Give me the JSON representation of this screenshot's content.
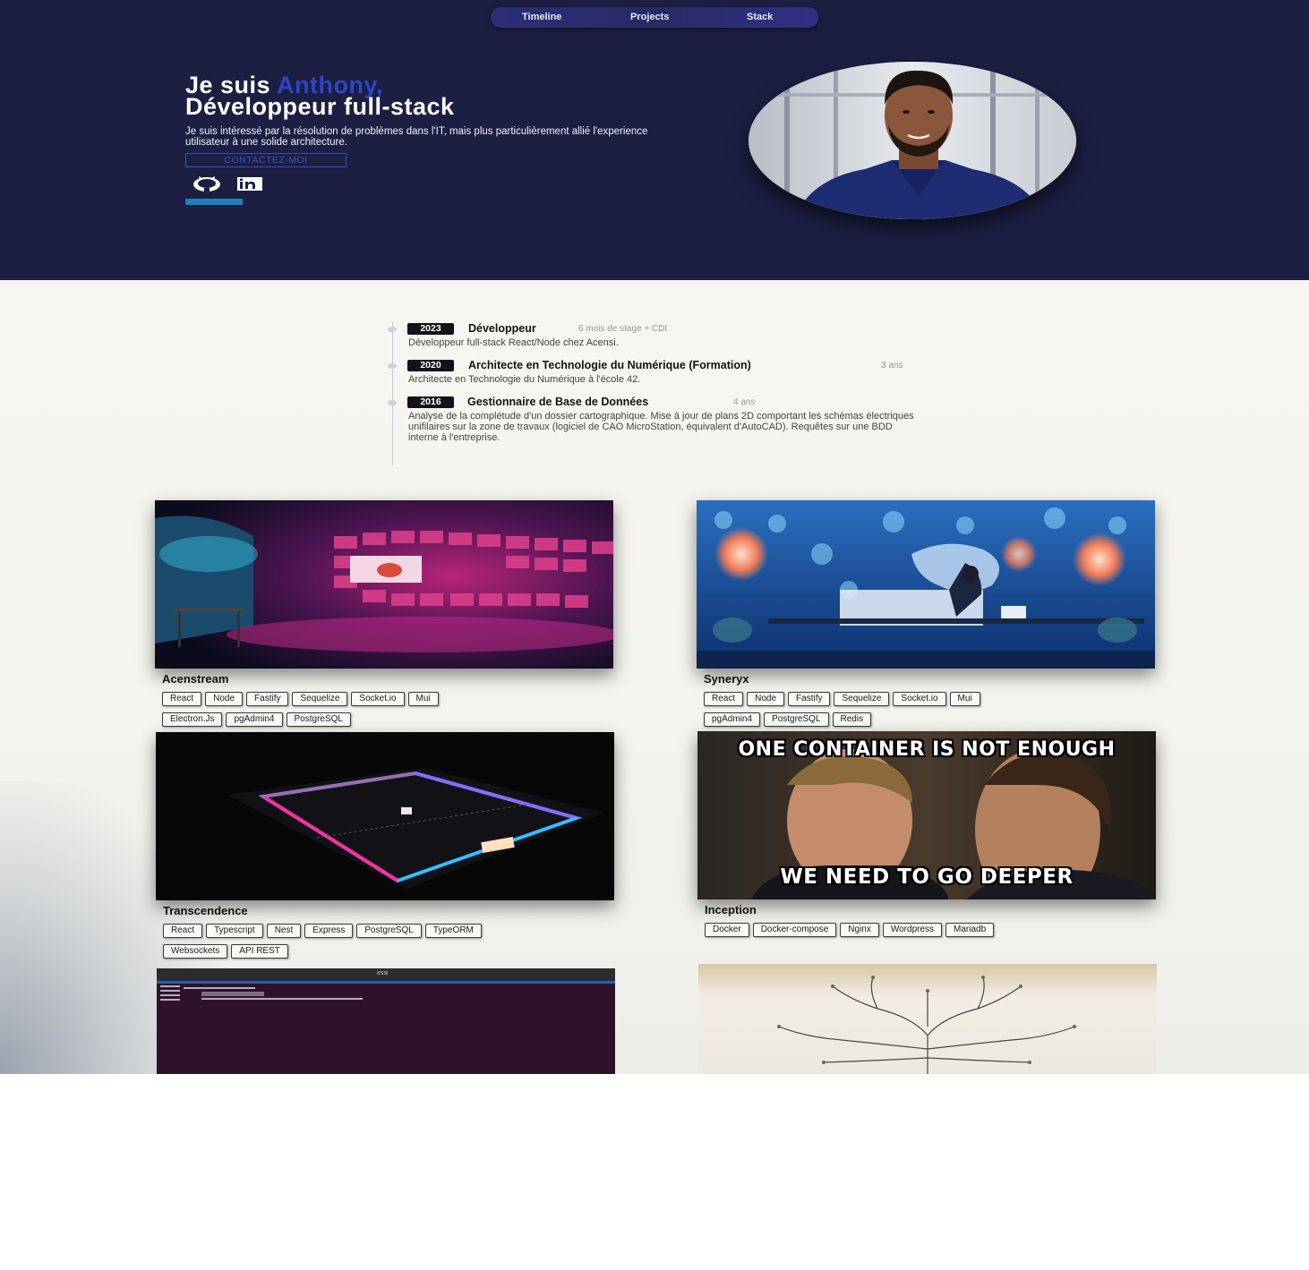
{
  "nav": {
    "items": [
      "Timeline",
      "Projects",
      "Stack"
    ]
  },
  "hero": {
    "title_prefix": "Je suis ",
    "name": "Anthony,",
    "title_line2": "Développeur full-stack",
    "description": "Je suis intéressé par la résolution de problèmes dans l'IT, mais plus particulièrement allié l'experience utilisateur à une solide architecture.",
    "contact_label": "CONTACTEZ-MOI",
    "social_icons": [
      "github-icon",
      "linkedin-icon"
    ],
    "accent_color": "#2d45c9"
  },
  "timeline": [
    {
      "year": "2023",
      "title": "Développeur",
      "duration": "6 mois de stage + CDI",
      "description": "Développeur full-stack React/Node chez Acensi."
    },
    {
      "year": "2020",
      "title": "Architecte en Technologie du Numérique (Formation)",
      "duration": "3 ans",
      "description": "Architecte en Technologie du Numérique à l'école 42."
    },
    {
      "year": "2016",
      "title": "Gestionnaire de Base de Données",
      "duration": "4 ans",
      "description": "Analyse de la complétude d'un dossier cartographique. Mise à jour de plans 2D comportant les schémas électriques unifilaires sur la zone de travaux (logiciel de CAO MicroStation, équivalent d'AutoCAD). Requêtes sur une BDD interne à l'entreprise."
    }
  ],
  "projects": [
    {
      "title": "Acenstream",
      "tags": [
        "React",
        "Node",
        "Fastify",
        "Sequelize",
        "Socket.io",
        "Mui",
        "Electron.Js",
        "pgAdmin4",
        "PostgreSQL"
      ]
    },
    {
      "title": "Syneryx",
      "tags": [
        "React",
        "Node",
        "Fastify",
        "Sequelize",
        "Socket.io",
        "Mui",
        "pgAdmin4",
        "PostgreSQL",
        "Redis"
      ]
    },
    {
      "title": "Transcendence",
      "tags": [
        "React",
        "Typescript",
        "Nest",
        "Express",
        "PostgreSQL",
        "TypeORM",
        "Websockets",
        "API REST"
      ]
    },
    {
      "title": "Inception",
      "tags": [
        "Docker",
        "Docker-compose",
        "Nginx",
        "Wordpress",
        "Mariadb"
      ],
      "meme_top": "ONE CONTAINER IS NOT ENOUGH",
      "meme_bottom": "WE NEED TO GO DEEPER"
    },
    {
      "title": "",
      "terminal_title": "irssi"
    },
    {
      "title": ""
    }
  ]
}
